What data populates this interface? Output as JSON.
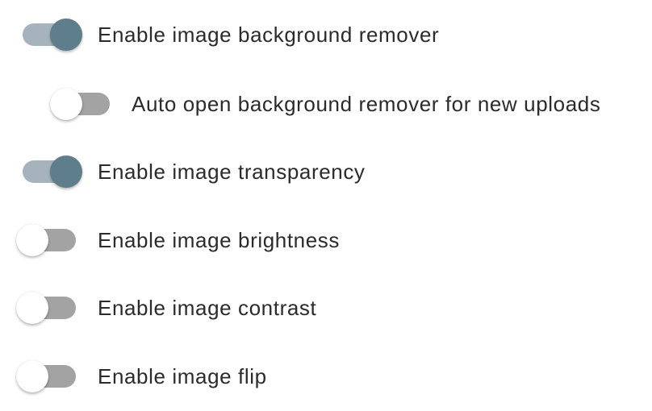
{
  "settings": [
    {
      "label": "Enable image background remover",
      "enabled": true
    },
    {
      "label": "Auto open background remover for new uploads",
      "enabled": false
    },
    {
      "label": "Enable image transparency",
      "enabled": true
    },
    {
      "label": "Enable image brightness",
      "enabled": false
    },
    {
      "label": "Enable image contrast",
      "enabled": false
    },
    {
      "label": "Enable image flip",
      "enabled": false
    }
  ],
  "colors": {
    "switch_on_thumb": "#5f7e8b",
    "switch_on_track": "#a6b3bc",
    "switch_off_thumb": "#ffffff",
    "switch_off_track": "#a3a3a3",
    "label_text": "#2b2b2b"
  }
}
